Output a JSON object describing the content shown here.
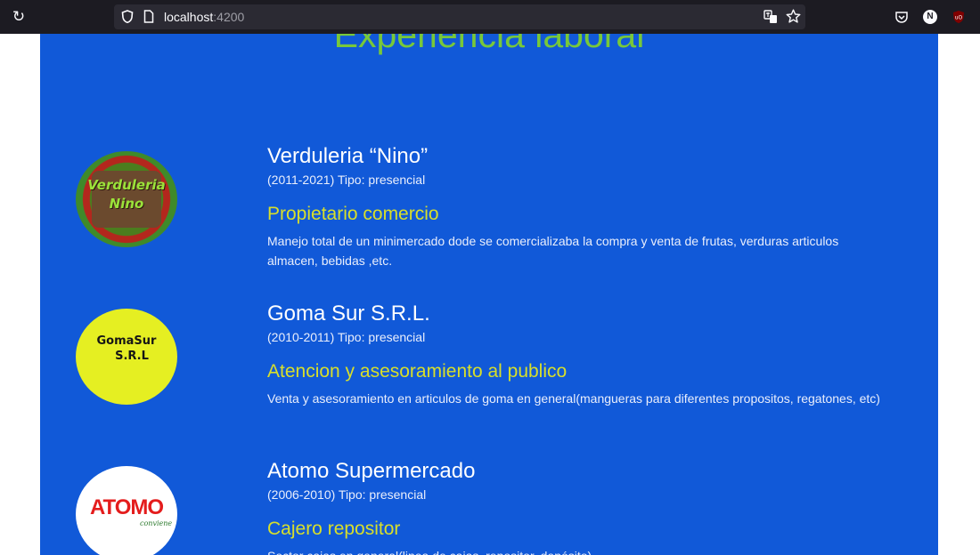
{
  "browser": {
    "url_host": "localhost",
    "url_port": ":4200",
    "account_initial": "N"
  },
  "section": {
    "title": "Experiencia laboral"
  },
  "jobs": [
    {
      "company": "Verduleria “Nino”",
      "period": "(2011-2021) Tipo: presencial",
      "role": "Propietario comercio",
      "description": "Manejo total de un minimercado dode se comercializaba la compra y venta de frutas, verduras articulos almacen, bebidas ,etc.",
      "logo_text_1": "Verduleria",
      "logo_text_2": "Nino"
    },
    {
      "company": "Goma Sur S.R.L.",
      "period": "(2010-2011) Tipo: presencial",
      "role": "Atencion y asesoramiento al publico",
      "description": "Venta y asesoramiento en articulos de goma en general(mangueras para diferentes propositos, regatones, etc)",
      "logo_text_1": "GomaSur",
      "logo_text_2": "S.R.L"
    },
    {
      "company": "Atomo Supermercado",
      "period": "(2006-2010) Tipo: presencial",
      "role": "Cajero repositor",
      "description": "Sector cajas en general(linea de cajas, repositor, depósito)",
      "logo_text_1": "ATOMO",
      "logo_text_2": "conviene"
    }
  ],
  "colors": {
    "page_background": "#1159d8",
    "title_green": "#78c83a",
    "role_yellow": "#d8df2a",
    "browser_chrome": "#1c1b22"
  }
}
